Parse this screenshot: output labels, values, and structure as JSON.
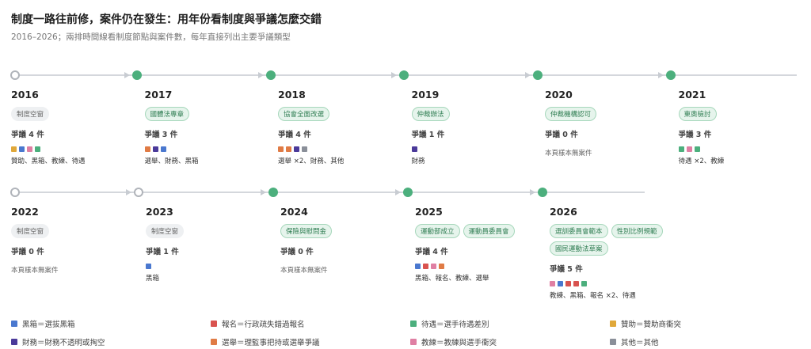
{
  "header": {
    "title": "制度一路往前修，案件仍在發生：用年份看制度與爭議怎麼交錯",
    "subtitle": "2016–2026；兩排時間線看制度節點與案件數，每年直接列出主要爭議類型"
  },
  "categories": {
    "blacklist": {
      "label": "黑箱＝選拔黑箱",
      "color": "#4a78cf"
    },
    "registration": {
      "label": "報名＝行政疏失錯過報名",
      "color": "#d9534f"
    },
    "treatment": {
      "label": "待遇＝選手待遇差別",
      "color": "#4caf7d"
    },
    "sponsorship": {
      "label": "贊助＝贊助商衝突",
      "color": "#e0a83a"
    },
    "finance": {
      "label": "財務＝財務不透明或掏空",
      "color": "#4b3a9a"
    },
    "election": {
      "label": "選舉＝理監事把持或選舉爭議",
      "color": "#e07b45"
    },
    "coaching": {
      "label": "教練＝教練與選手衝突",
      "color": "#df7fa3"
    },
    "other": {
      "label": "其他＝其他",
      "color": "#8a8f99"
    }
  },
  "legend_order": [
    "blacklist",
    "registration",
    "treatment",
    "sponsorship",
    "finance",
    "election",
    "coaching",
    "other"
  ],
  "chart_data": {
    "type": "timeline",
    "rows": [
      [
        {
          "year": "2016",
          "milestone": true,
          "node": "hollow",
          "tags": [
            {
              "text": "制度空窗",
              "style": "grey"
            }
          ],
          "count_text": "爭議 4 件",
          "disputes": 4,
          "types": [
            "sponsorship",
            "blacklist",
            "coaching",
            "treatment"
          ],
          "types_text": "贊助、黑箱、教練、待遇"
        },
        {
          "year": "2017",
          "node": "filled",
          "tags": [
            {
              "text": "國體法專章",
              "style": "green"
            }
          ],
          "count_text": "爭議 3 件",
          "disputes": 3,
          "types": [
            "election",
            "finance",
            "blacklist"
          ],
          "types_text": "選舉、財務、黑箱"
        },
        {
          "year": "2018",
          "node": "filled",
          "tags": [
            {
              "text": "協會全面改選",
              "style": "green"
            }
          ],
          "count_text": "爭議 4 件",
          "disputes": 4,
          "types": [
            "election",
            "election",
            "finance",
            "other"
          ],
          "types_text": "選舉 ×2、財務、其他"
        },
        {
          "year": "2019",
          "node": "filled",
          "tags": [
            {
              "text": "仲裁辦法",
              "style": "green"
            }
          ],
          "count_text": "爭議 1 件",
          "disputes": 1,
          "types": [
            "finance"
          ],
          "types_text": "財務"
        },
        {
          "year": "2020",
          "node": "filled",
          "tags": [
            {
              "text": "仲裁機構認可",
              "style": "green"
            }
          ],
          "count_text": "爭議 0 件",
          "disputes": 0,
          "types": [],
          "types_text": "本頁樣本無案件"
        },
        {
          "year": "2021",
          "node": "filled",
          "tags": [
            {
              "text": "東奧檢討",
              "style": "green"
            }
          ],
          "count_text": "爭議 3 件",
          "disputes": 3,
          "types": [
            "treatment",
            "coaching",
            "treatment"
          ],
          "types_text": "待遇 ×2、教練"
        }
      ],
      [
        {
          "year": "2022",
          "node": "hollow",
          "tags": [
            {
              "text": "制度空窗",
              "style": "grey"
            }
          ],
          "count_text": "爭議 0 件",
          "disputes": 0,
          "types": [],
          "types_text": "本頁樣本無案件"
        },
        {
          "year": "2023",
          "node": "hollow",
          "tags": [
            {
              "text": "制度空窗",
              "style": "grey"
            }
          ],
          "count_text": "爭議 1 件",
          "disputes": 1,
          "types": [
            "blacklist"
          ],
          "types_text": "黑箱"
        },
        {
          "year": "2024",
          "node": "filled",
          "tags": [
            {
              "text": "保險與慰問金",
              "style": "green"
            }
          ],
          "count_text": "爭議 0 件",
          "disputes": 0,
          "types": [],
          "types_text": "本頁樣本無案件"
        },
        {
          "year": "2025",
          "node": "filled",
          "tags": [
            {
              "text": "運動部成立",
              "style": "green"
            },
            {
              "text": "運動員委員會",
              "style": "green"
            }
          ],
          "count_text": "爭議 4 件",
          "disputes": 4,
          "types": [
            "blacklist",
            "registration",
            "coaching",
            "election"
          ],
          "types_text": "黑箱、報名、教練、選舉"
        },
        {
          "year": "2026",
          "node": "filled",
          "tags": [
            {
              "text": "選訓委員會範本",
              "style": "green"
            },
            {
              "text": "性別比例規範",
              "style": "green"
            },
            {
              "text": "國民運動法草案",
              "style": "green"
            }
          ],
          "count_text": "爭議 5 件",
          "disputes": 5,
          "types": [
            "coaching",
            "blacklist",
            "registration",
            "registration",
            "treatment"
          ],
          "types_text": "教練、黑箱、報名 ×2、待遇"
        }
      ]
    ]
  }
}
